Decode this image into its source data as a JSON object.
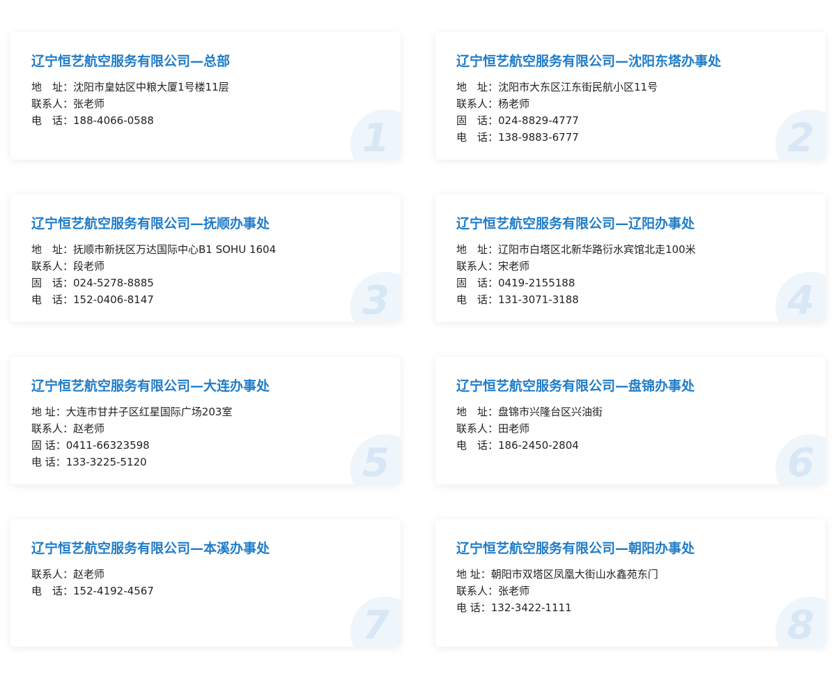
{
  "cards": [
    {
      "title": "辽宁恒艺航空服务有限公司—总部",
      "lines": [
        "地　址：沈阳市皇姑区中粮大厦1号楼11层",
        "联系人：张老师",
        "电　话：188-4066-0588"
      ],
      "number": "1"
    },
    {
      "title": "辽宁恒艺航空服务有限公司—沈阳东塔办事处",
      "lines": [
        "地　址：沈阳市大东区江东街民航小区11号",
        "联系人：杨老师",
        "固　话：024-8829-4777",
        "电　话：138-9883-6777"
      ],
      "number": "2"
    },
    {
      "title": "辽宁恒艺航空服务有限公司—抚顺办事处",
      "lines": [
        "地　址：抚顺市新抚区万达国际中心B1 SOHU 1604",
        "联系人：段老师",
        "固　话：024-5278-8885",
        "电　话：152-0406-8147"
      ],
      "number": "3"
    },
    {
      "title": "辽宁恒艺航空服务有限公司—辽阳办事处",
      "lines": [
        "地　址：辽阳市白塔区北新华路衍水宾馆北走100米",
        "联系人：宋老师",
        "固　话：0419-2155188",
        "电　话：131-3071-3188"
      ],
      "number": "4"
    },
    {
      "title": "辽宁恒艺航空服务有限公司—大连办事处",
      "lines": [
        "地 址：大连市甘井子区红星国际广场203室",
        "联系人：赵老师",
        "固 话：0411-66323598",
        "电 话：133-3225-5120"
      ],
      "number": "5"
    },
    {
      "title": "辽宁恒艺航空服务有限公司—盘锦办事处",
      "lines": [
        "地　址：盘锦市兴隆台区兴油街",
        "联系人：田老师",
        "电　话：186-2450-2804"
      ],
      "number": "6"
    },
    {
      "title": "辽宁恒艺航空服务有限公司—本溪办事处",
      "lines": [
        "联系人：赵老师",
        "电　话：152-4192-4567"
      ],
      "number": "7"
    },
    {
      "title": "辽宁恒艺航空服务有限公司—朝阳办事处",
      "lines": [
        "地 址：朝阳市双塔区凤凰大街山水鑫苑东门",
        "联系人：张老师",
        "电 话：132-3422-1111"
      ],
      "number": "8"
    }
  ],
  "colors": {
    "title": "#1f7cc8",
    "text": "#222222",
    "badge_circle": "#eef5fb",
    "badge_digit": "#d8e7f5",
    "card_bg": "#ffffff"
  }
}
